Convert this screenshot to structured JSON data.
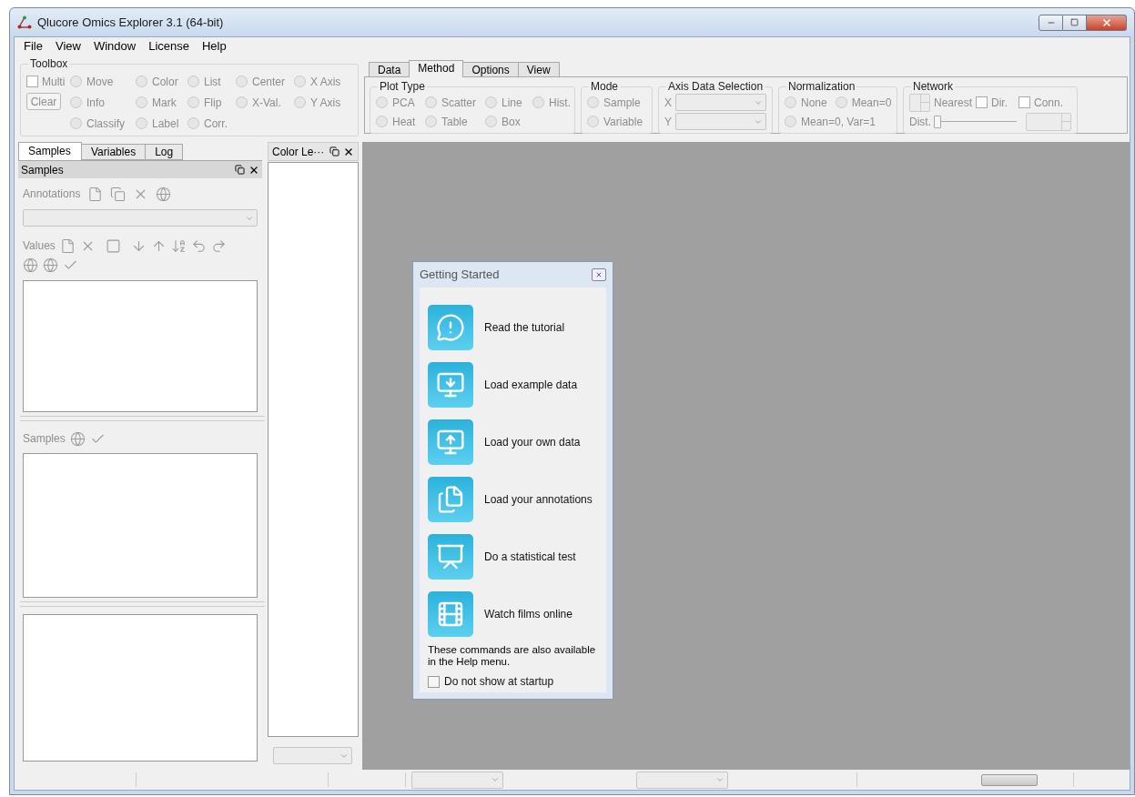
{
  "window": {
    "title": "Qlucore Omics Explorer 3.1 (64-bit)"
  },
  "menu": [
    {
      "label": "File"
    },
    {
      "label": "View"
    },
    {
      "label": "Window"
    },
    {
      "label": "License"
    },
    {
      "label": "Help"
    }
  ],
  "toolbox": {
    "title": "Toolbox",
    "multi": {
      "label": "Multi",
      "checked": false
    },
    "clear_button": "Clear",
    "radios": [
      {
        "label": "Move",
        "selected": false
      },
      {
        "label": "Color",
        "selected": false
      },
      {
        "label": "List",
        "selected": false
      },
      {
        "label": "Center",
        "selected": false
      },
      {
        "label": "X Axis",
        "selected": false
      },
      {
        "label": "Info",
        "selected": false
      },
      {
        "label": "Mark",
        "selected": false
      },
      {
        "label": "Flip",
        "selected": false
      },
      {
        "label": "X-Val.",
        "selected": false
      },
      {
        "label": "Y Axis",
        "selected": false
      },
      {
        "label": "Classify",
        "selected": false
      },
      {
        "label": "Label",
        "selected": false
      },
      {
        "label": "Corr.",
        "selected": false
      }
    ]
  },
  "method_tabs": [
    {
      "label": "Data",
      "selected": false
    },
    {
      "label": "Method",
      "selected": true
    },
    {
      "label": "Options",
      "selected": false
    },
    {
      "label": "View",
      "selected": false
    }
  ],
  "plot_type": {
    "title": "Plot Type",
    "radios": [
      {
        "label": "PCA",
        "selected": false
      },
      {
        "label": "Scatter",
        "selected": false
      },
      {
        "label": "Line",
        "selected": false
      },
      {
        "label": "Hist.",
        "selected": false
      },
      {
        "label": "Heat",
        "selected": false
      },
      {
        "label": "Table",
        "selected": false
      },
      {
        "label": "Box",
        "selected": false
      }
    ]
  },
  "mode": {
    "title": "Mode",
    "radios": [
      {
        "label": "Sample",
        "selected": false
      },
      {
        "label": "Variable",
        "selected": false
      }
    ]
  },
  "axis_data_selection": {
    "title": "Axis Data Selection",
    "axes": [
      {
        "label": "X"
      },
      {
        "label": "Y"
      }
    ]
  },
  "normalization": {
    "title": "Normalization",
    "radios": [
      {
        "label": "None",
        "selected": false
      },
      {
        "label": "Mean=0",
        "selected": false
      },
      {
        "label": "Mean=0, Var=1",
        "selected": false
      }
    ]
  },
  "network": {
    "title": "Network",
    "nearest_label": "Nearest",
    "dir": {
      "label": "Dir.",
      "checked": false
    },
    "conn": {
      "label": "Conn.",
      "checked": false
    },
    "dist_label": "Dist.",
    "dist_slider": {
      "level": 0
    }
  },
  "side_tabs": [
    {
      "label": "Samples",
      "selected": true
    },
    {
      "label": "Variables",
      "selected": false
    },
    {
      "label": "Log",
      "selected": false
    }
  ],
  "samples_panel": {
    "title": "Samples",
    "annotations_label": "Annotations",
    "values_label": "Values",
    "samples_label": "Samples"
  },
  "color_legend": {
    "title": "Color Le···"
  },
  "getting_started": {
    "title": "Getting Started",
    "commands": [
      {
        "label": "Read the tutorial"
      },
      {
        "label": "Load example data"
      },
      {
        "label": "Load your own data"
      },
      {
        "label": "Load your annotations"
      },
      {
        "label": "Do a statistical test"
      },
      {
        "label": "Watch films online"
      }
    ],
    "note": "These commands are also available in the Help menu.",
    "dont_show": {
      "label": "Do not show at startup",
      "checked": false
    }
  }
}
